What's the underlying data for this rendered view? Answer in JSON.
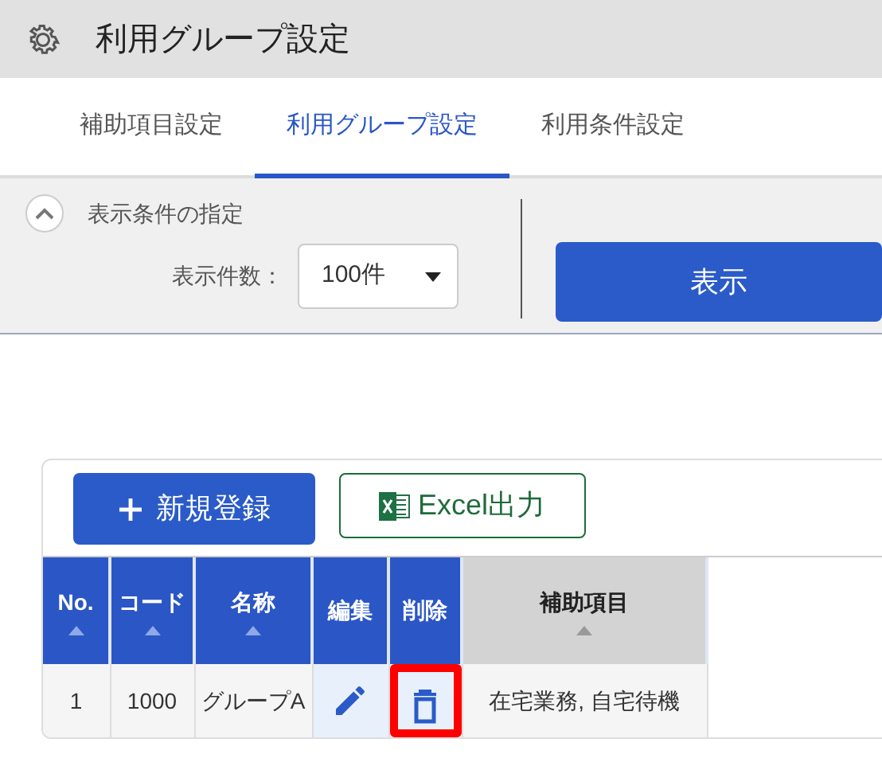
{
  "header": {
    "title": "利用グループ設定"
  },
  "tabs": [
    {
      "label": "補助項目設定",
      "selected": false
    },
    {
      "label": "利用グループ設定",
      "selected": true
    },
    {
      "label": "利用条件設定",
      "selected": false
    }
  ],
  "filter": {
    "title": "表示条件の指定",
    "expanded": true,
    "count_label": "表示件数：",
    "count_value": "100件",
    "show_button": "表示"
  },
  "toolbar": {
    "new_button": "新規登録",
    "excel_button": "Excel出力"
  },
  "table": {
    "columns": [
      {
        "label": "No.",
        "sorted": false
      },
      {
        "label": "コード",
        "sorted": false
      },
      {
        "label": "名称",
        "sorted": false
      },
      {
        "label": "編集",
        "kind": "action",
        "sorted": false
      },
      {
        "label": "削除",
        "kind": "action",
        "sorted": false
      },
      {
        "label": "補助項目",
        "sorted": true
      }
    ],
    "rows": [
      {
        "no": "1",
        "code": "1000",
        "name": "グループA",
        "items": "在宅業務, 自宅待機",
        "delete_highlighted": true
      }
    ]
  }
}
